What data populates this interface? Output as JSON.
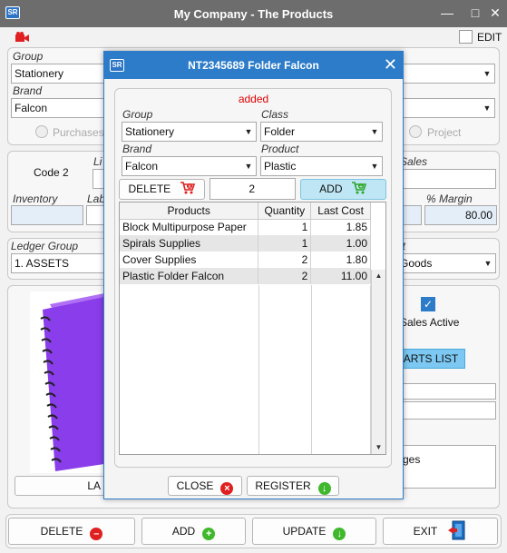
{
  "window": {
    "logo": "SR",
    "title": "My Company - The Products"
  },
  "top": {
    "edit_label": "EDIT"
  },
  "main": {
    "group_label": "Group",
    "group_value": "Stationery",
    "brand_label": "Brand",
    "brand_value": "Falcon",
    "radio_purchases": "Purchases",
    "radio_project": "Project",
    "code_label": "Code 2",
    "li_label": "Li",
    "sales_label": "Sales",
    "inventory_label": "Inventory",
    "labels_label": "Lab",
    "margin_label": "% Margin",
    "margin_value": "80.00",
    "ledger_label": "Ledger Group",
    "ledger_value": "1. ASSETS",
    "account_label": "nt",
    "account_value": "Goods",
    "sales_active_label": "Sales Active",
    "parts_list_label": "ARTS LIST",
    "notes_text": "ges",
    "image_button_label": "LA"
  },
  "bottom_bar": {
    "delete_label": "DELETE",
    "add_label": "ADD",
    "update_label": "UPDATE",
    "exit_label": "EXIT"
  },
  "dialog": {
    "logo": "SR",
    "title": "NT2345689 Folder Falcon",
    "status_text": "added",
    "group_label": "Group",
    "group_value": "Stationery",
    "class_label": "Class",
    "class_value": "Folder",
    "brand_label": "Brand",
    "brand_value": "Falcon",
    "product_label": "Product",
    "product_value": "Plastic",
    "delete_label": "DELETE",
    "quantity_value": "2",
    "add_label": "ADD",
    "table": {
      "headers": [
        "Products",
        "Quantity",
        "Last Cost"
      ],
      "rows": [
        [
          "Block Multipurpose Paper",
          "1",
          "1.85"
        ],
        [
          "Spirals Supplies",
          "1",
          "1.00"
        ],
        [
          "Cover Supplies",
          "2",
          "1.80"
        ],
        [
          "Plastic Folder Falcon",
          "2",
          "11.00"
        ]
      ]
    },
    "close_label": "CLOSE",
    "register_label": "REGISTER"
  },
  "colors": {
    "accent": "#2d7cc9",
    "status": "#e00000"
  }
}
